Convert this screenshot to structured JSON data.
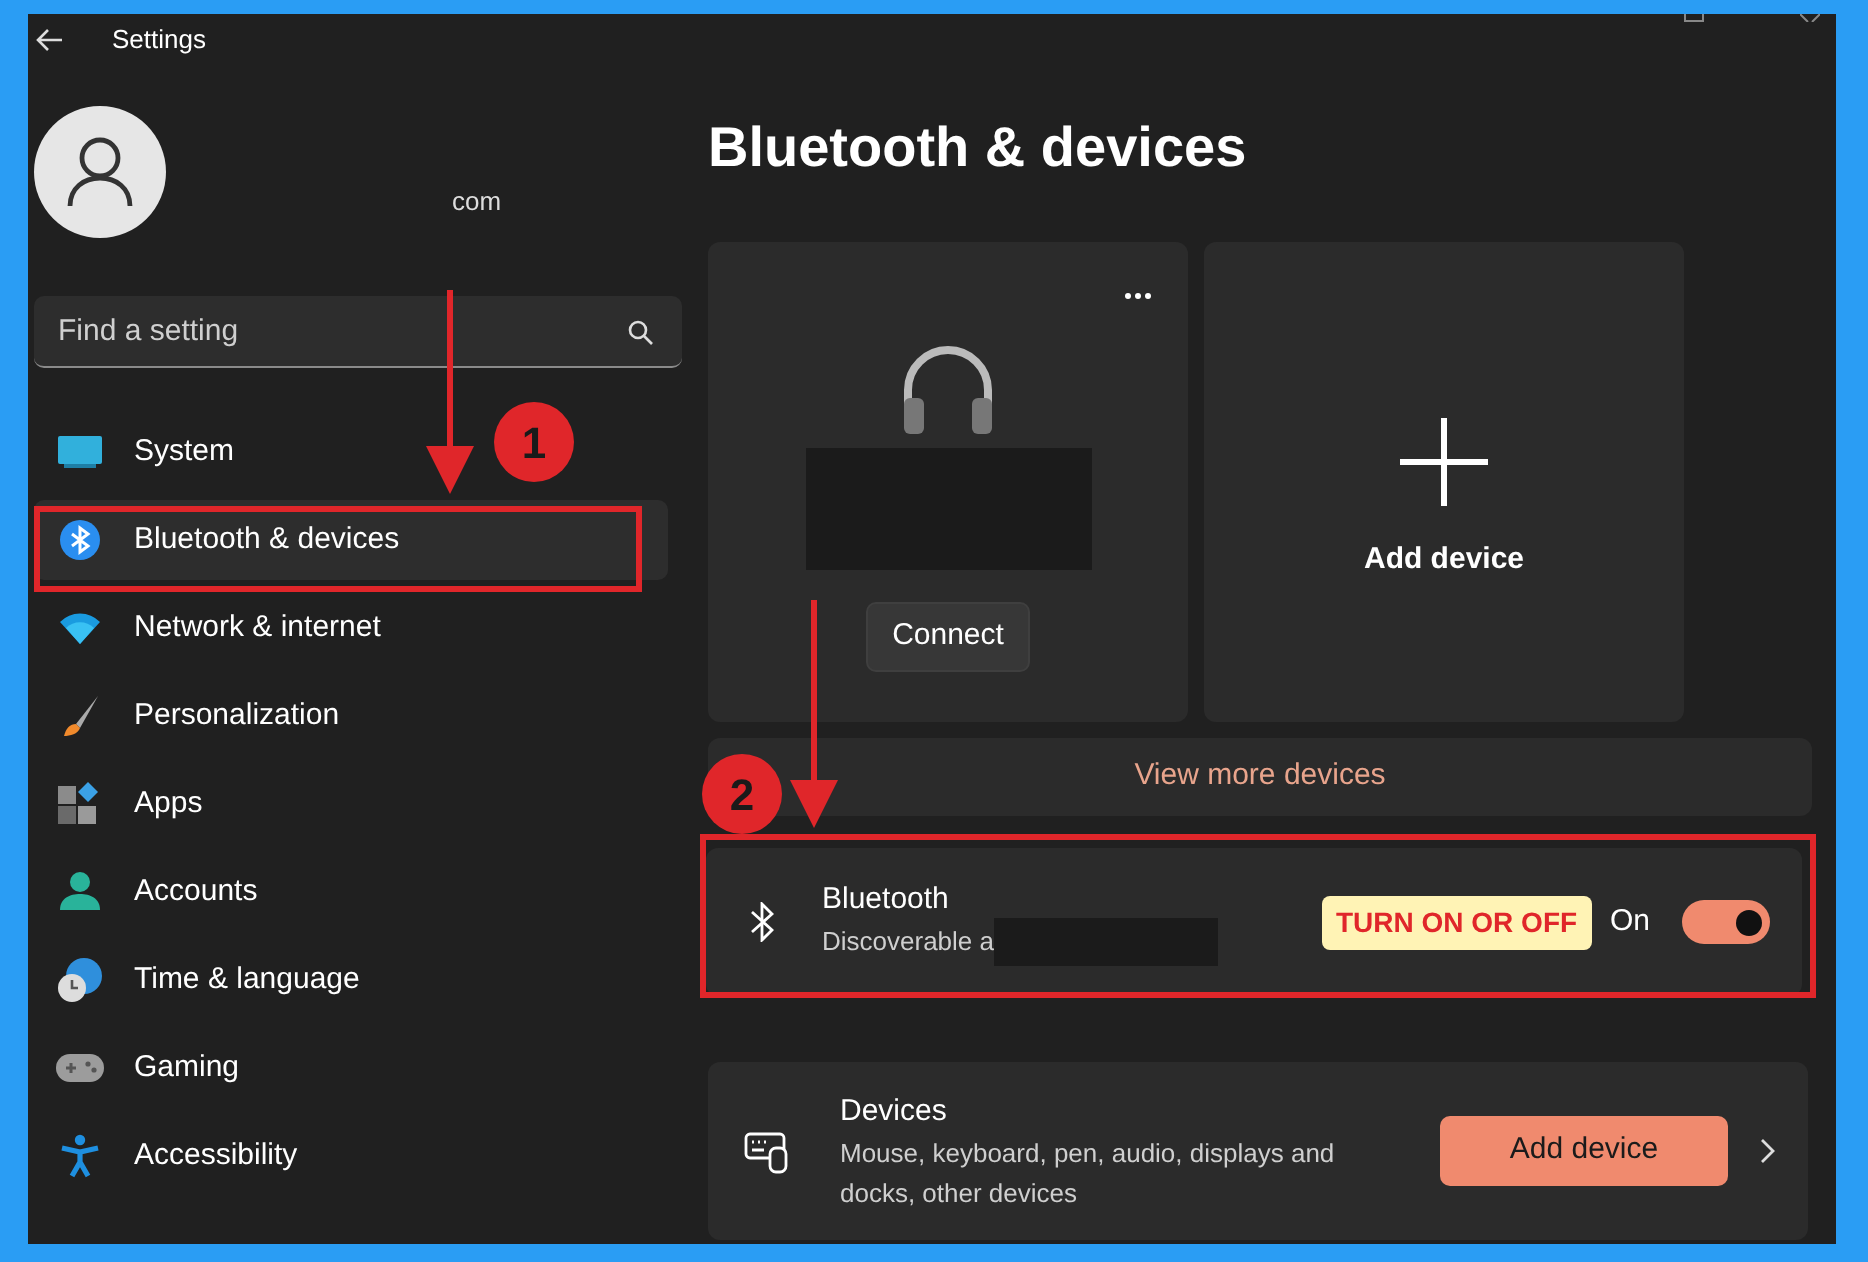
{
  "window": {
    "title": "Settings"
  },
  "account": {
    "email_fragment": "com"
  },
  "search": {
    "placeholder": "Find a setting"
  },
  "sidebar": {
    "items": [
      {
        "label": "System",
        "selected": false
      },
      {
        "label": "Bluetooth & devices",
        "selected": true
      },
      {
        "label": "Network & internet",
        "selected": false
      },
      {
        "label": "Personalization",
        "selected": false
      },
      {
        "label": "Apps",
        "selected": false
      },
      {
        "label": "Accounts",
        "selected": false
      },
      {
        "label": "Time & language",
        "selected": false
      },
      {
        "label": "Gaming",
        "selected": false
      },
      {
        "label": "Accessibility",
        "selected": false
      }
    ]
  },
  "page": {
    "title": "Bluetooth & devices",
    "tiles": [
      {
        "kind": "device",
        "button": "Connect"
      },
      {
        "kind": "add",
        "label": "Add device"
      }
    ],
    "view_more": "View more devices",
    "bluetooth": {
      "title": "Bluetooth",
      "subtitle": "Discoverable a",
      "status": "On",
      "on": true
    },
    "devices": {
      "title": "Devices",
      "description": "Mouse, keyboard, pen, audio, displays and docks, other devices",
      "button": "Add device"
    }
  },
  "annotations": {
    "steps": [
      "1",
      "2"
    ],
    "callout": "TURN ON OR OFF"
  }
}
